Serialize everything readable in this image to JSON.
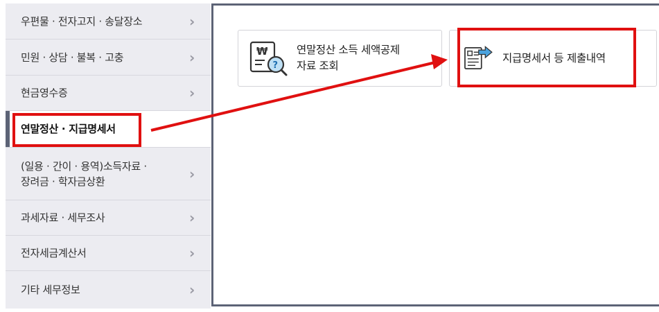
{
  "sidebar": {
    "items": [
      {
        "label": "우편물 · 전자고지 · 송달장소"
      },
      {
        "label": "민원 · 상담 · 불복 · 고충"
      },
      {
        "label": "현금영수증"
      },
      {
        "label": "연말정산 · 지급명세서"
      },
      {
        "label": "(일용 · 간이 · 용역)소득자료 ·",
        "label2": "장려금 · 학자금상환"
      },
      {
        "label": "과세자료 · 세무조사"
      },
      {
        "label": "전자세금계산서"
      },
      {
        "label": "기타 세무정보"
      }
    ],
    "active_index": 3,
    "chevron": "›"
  },
  "cards": [
    {
      "line1": "연말정산 소득 세액공제",
      "line2": "자료 조회",
      "icon": "won-document-search-icon"
    },
    {
      "line1": "지급명세서 등 제출내역",
      "icon": "document-submit-arrow-icon"
    }
  ],
  "colors": {
    "highlight": "#e01010",
    "sidebar_bg": "#ececf1",
    "panel_border": "#5c6376",
    "icon_blue": "#4aa3df"
  }
}
